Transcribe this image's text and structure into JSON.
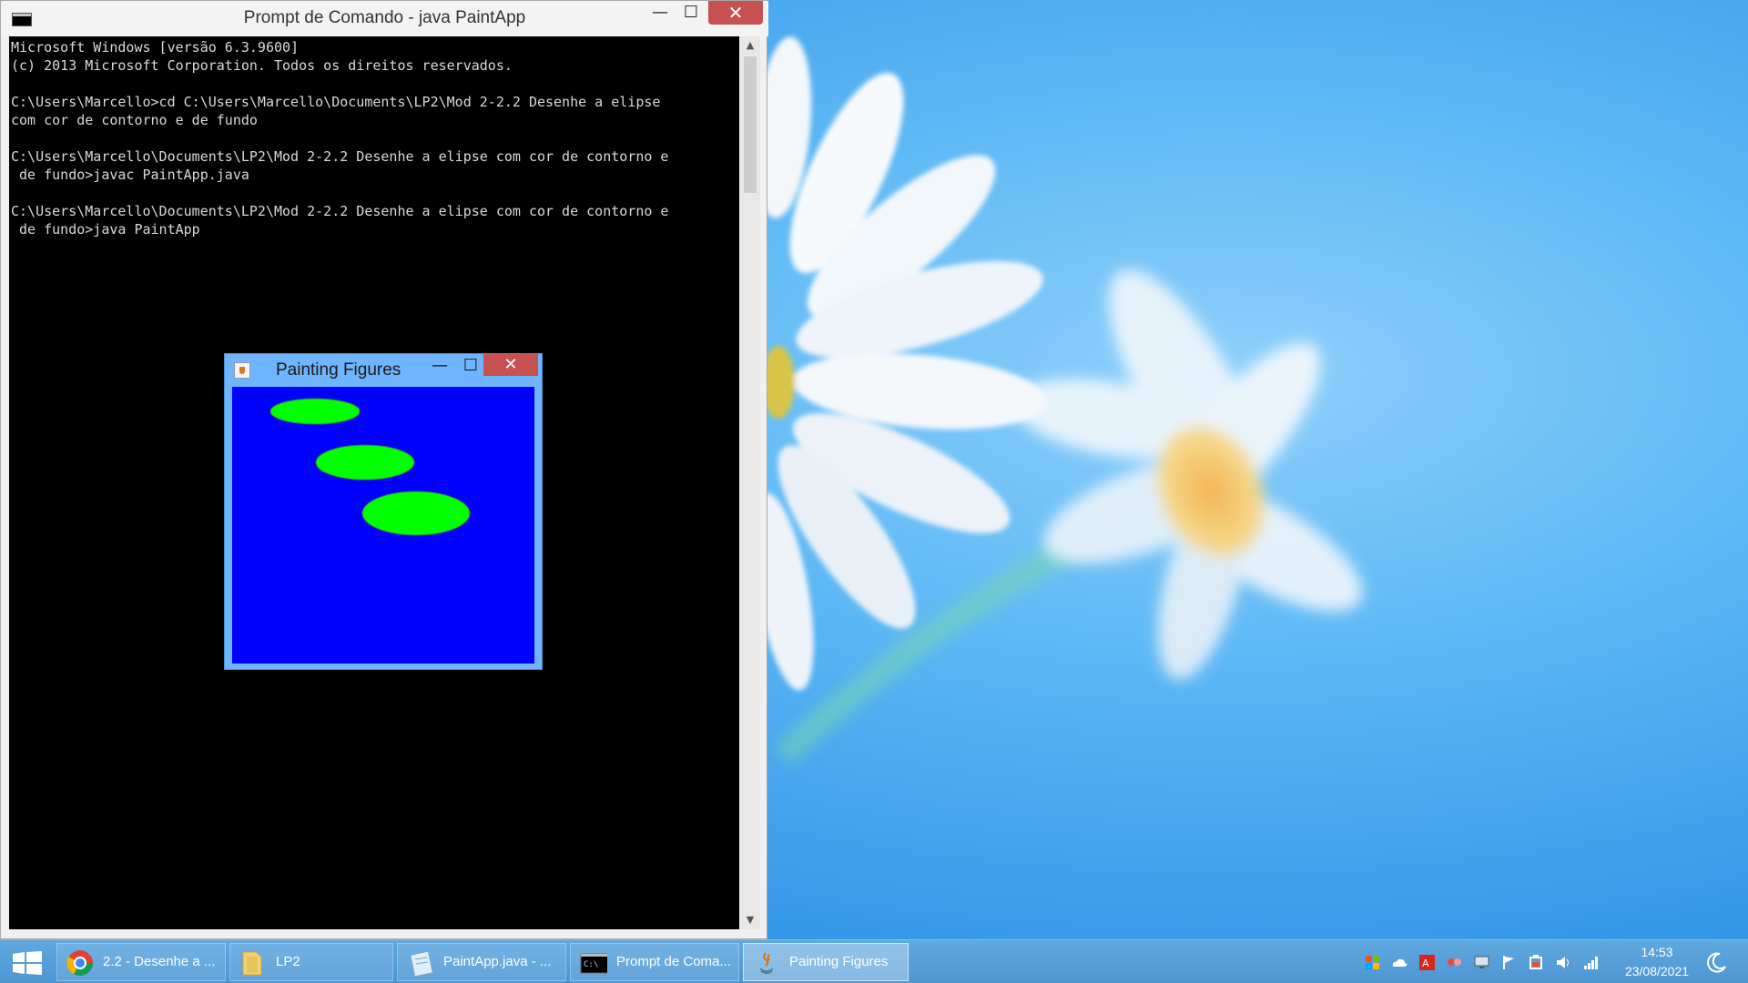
{
  "cmd": {
    "title": "Prompt de Comando - java  PaintApp",
    "lines": [
      "Microsoft Windows [versão 6.3.9600]",
      "(c) 2013 Microsoft Corporation. Todos os direitos reservados.",
      "",
      "C:\\Users\\Marcello>cd C:\\Users\\Marcello\\Documents\\LP2\\Mod 2-2.2 Desenhe a elipse",
      "com cor de contorno e de fundo",
      "",
      "C:\\Users\\Marcello\\Documents\\LP2\\Mod 2-2.2 Desenhe a elipse com cor de contorno e",
      " de fundo>javac PaintApp.java",
      "",
      "C:\\Users\\Marcello\\Documents\\LP2\\Mod 2-2.2 Desenhe a elipse com cor de contorno e",
      " de fundo>java PaintApp"
    ],
    "minimize": "—",
    "maximize": "☐",
    "close": "✕"
  },
  "painting": {
    "title": "Painting Figures",
    "minimize": "—",
    "maximize": "☐",
    "close": "✕",
    "canvas_color": "#0000ff",
    "ellipse_color": "#00ff00"
  },
  "taskbar": {
    "items": [
      {
        "label": "2.2 - Desenhe a ...",
        "icon": "chrome-icon"
      },
      {
        "label": "LP2",
        "icon": "folder-icon"
      },
      {
        "label": "PaintApp.java - ...",
        "icon": "notepad-icon"
      },
      {
        "label": "Prompt de Coma...",
        "icon": "cmd-icon"
      },
      {
        "label": "Painting Figures",
        "icon": "java-icon"
      }
    ],
    "clock_time": "14:53",
    "clock_date": "23/08/2021"
  },
  "colors": {
    "desktop": "#3aa0ea",
    "taskbar": "#5fa8e0",
    "close_button": "#c75050"
  }
}
